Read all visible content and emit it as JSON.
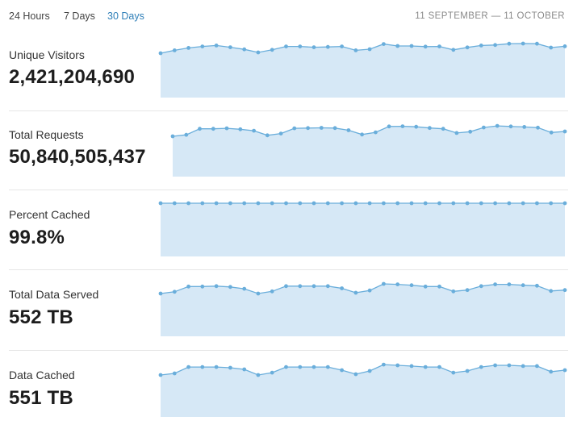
{
  "tabs": [
    {
      "label": "24 Hours",
      "active": false
    },
    {
      "label": "7 Days",
      "active": false
    },
    {
      "label": "30 Days",
      "active": true
    }
  ],
  "date_range": "11 SEPTEMBER — 11 OCTOBER",
  "colors": {
    "accent": "#2f7fb8",
    "spark_fill": "#d6e8f6",
    "spark_line": "#6aaedb"
  },
  "metrics": [
    {
      "label": "Unique Visitors",
      "value": "2,421,204,690",
      "trend": [
        0.0,
        0.3,
        0.55,
        0.7,
        0.8,
        0.62,
        0.4,
        0.08,
        0.35,
        0.7,
        0.7,
        0.62,
        0.65,
        0.7,
        0.3,
        0.42,
        0.95,
        0.75,
        0.75,
        0.68,
        0.7,
        0.35,
        0.6,
        0.8,
        0.85,
        0.98,
        1.0,
        0.98,
        0.58,
        0.72
      ]
    },
    {
      "label": "Total Requests",
      "value": "50,840,505,437",
      "trend": [
        0.0,
        0.12,
        0.62,
        0.62,
        0.66,
        0.58,
        0.46,
        0.08,
        0.23,
        0.66,
        0.68,
        0.7,
        0.68,
        0.5,
        0.15,
        0.33,
        0.81,
        0.83,
        0.79,
        0.69,
        0.62,
        0.27,
        0.38,
        0.73,
        0.86,
        0.81,
        0.77,
        0.71,
        0.31,
        0.4
      ]
    },
    {
      "label": "Percent Cached",
      "value": "99.8%",
      "trend": [
        0.5,
        0.5,
        0.5,
        0.5,
        0.5,
        0.5,
        0.5,
        0.5,
        0.5,
        0.5,
        0.5,
        0.5,
        0.5,
        0.5,
        0.5,
        0.5,
        0.5,
        0.5,
        0.5,
        0.5,
        0.5,
        0.5,
        0.5,
        0.5,
        0.5,
        0.5,
        0.5,
        0.5,
        0.5,
        0.5
      ]
    },
    {
      "label": "Total Data Served",
      "value": "552 TB",
      "trend": [
        0.0,
        0.17,
        0.67,
        0.67,
        0.71,
        0.63,
        0.45,
        0.0,
        0.21,
        0.71,
        0.71,
        0.71,
        0.71,
        0.5,
        0.08,
        0.29,
        0.92,
        0.88,
        0.79,
        0.67,
        0.67,
        0.21,
        0.33,
        0.71,
        0.88,
        0.88,
        0.79,
        0.75,
        0.25,
        0.33
      ]
    },
    {
      "label": "Data Cached",
      "value": "551 TB",
      "trend": [
        0.0,
        0.14,
        0.71,
        0.71,
        0.71,
        0.64,
        0.5,
        0.0,
        0.21,
        0.71,
        0.71,
        0.71,
        0.71,
        0.43,
        0.07,
        0.36,
        0.92,
        0.86,
        0.79,
        0.71,
        0.71,
        0.21,
        0.36,
        0.71,
        0.86,
        0.86,
        0.79,
        0.79,
        0.29,
        0.43
      ]
    }
  ]
}
